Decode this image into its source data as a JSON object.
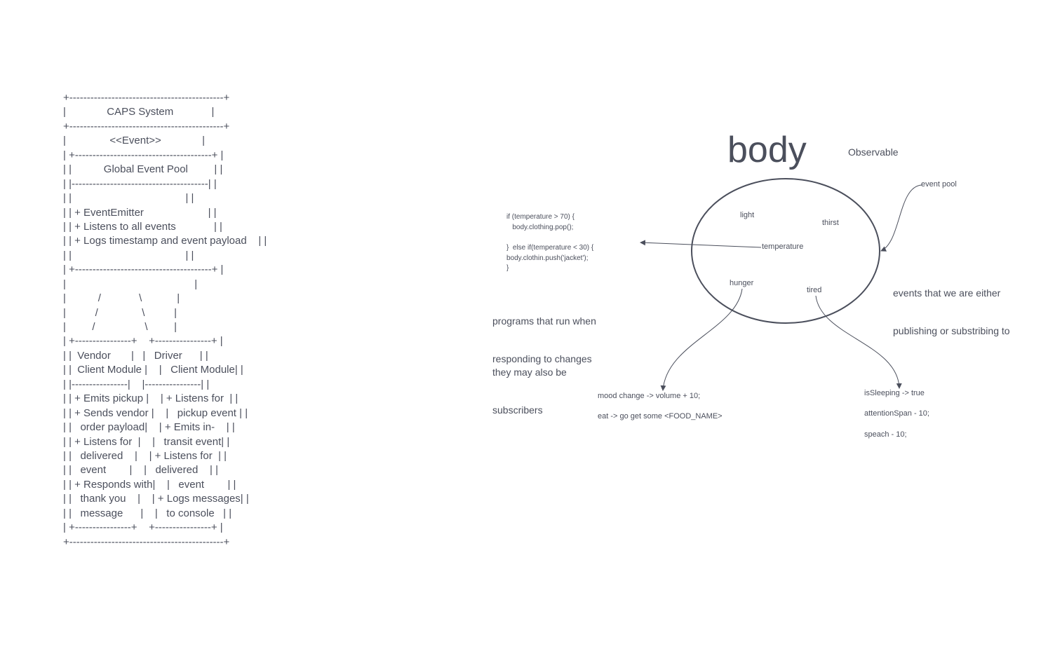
{
  "ascii_diagram": {
    "lines": [
      "+--------------------------------------------+",
      "|              CAPS System             |",
      "+--------------------------------------------+",
      "|               <<Event>>              |",
      "| +---------------------------------------+ |",
      "| |           Global Event Pool         | |",
      "| |---------------------------------------| |",
      "| |                                       | |",
      "| | + EventEmitter                      | |",
      "| | + Listens to all events             | |",
      "| | + Logs timestamp and event payload    | |",
      "| |                                       | |",
      "| +---------------------------------------+ |",
      "|                                            |",
      "|           /             \\            |",
      "|          /               \\          |",
      "|         /                 \\         |",
      "| +----------------+    +----------------+ |",
      "| |  Vendor       |   |   Driver      | |",
      "| |  Client Module |    |   Client Module| |",
      "| |----------------|    |----------------| |",
      "| | + Emits pickup |    | + Listens for  | |",
      "| | + Sends vendor |    |   pickup event | |",
      "| |   order payload|    | + Emits in-    | |",
      "| | + Listens for  |    |   transit event| |",
      "| |   delivered    |    | + Listens for  | |",
      "| |   event        |    |   delivered    | |",
      "| | + Responds with|    |   event        | |",
      "| |   thank you    |    | + Logs messages| |",
      "| |   message      |    |   to console   | |",
      "| +----------------+    +----------------+ |",
      "+--------------------------------------------+"
    ]
  },
  "observer_diagram": {
    "title": "body",
    "subtitle": "Observable",
    "event_pool_label": "event pool",
    "events_note": [
      "events that we are either",
      "publishing or substribing to"
    ],
    "nodes": {
      "light": "light",
      "thirst": "thirst",
      "temperature": "temperature",
      "hunger": "hunger",
      "tired": "tired"
    },
    "temperature_code": [
      "if (temperature > 70) {",
      "   body.clothing.pop();",
      "",
      "}  else if(temperature < 30) {",
      "body.clothin.push('jacket');",
      "}"
    ],
    "programs_note": [
      "programs that run when",
      "responding to changes"
    ],
    "subscribers_note": [
      "they may also be",
      "subscribers"
    ],
    "hunger_actions": [
      "mood change -> volume + 10;",
      "eat -> go get some <FOOD_NAME>"
    ],
    "tired_actions": [
      "isSleeping -> true",
      "attentionSpan - 10;",
      "speach - 10;"
    ]
  },
  "colors": {
    "ink": "#4b4f5c"
  }
}
